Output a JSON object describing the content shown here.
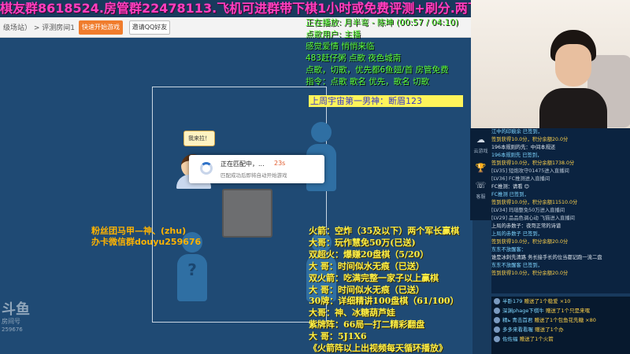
{
  "marquee": "棋友群8618524.房管群22478113.飞机可进群带下棋1小时或免费评测+刷分.两飞机或钻粉升房管",
  "game_topbar": {
    "breadcrumb": "级场站） > 评测房间1",
    "start_button": "快速开始游戏",
    "invite_button": "邀请QQ好友"
  },
  "game": {
    "speech_bubble": "我来拉！",
    "unknown_seat": "?",
    "matching_dialog": {
      "title": "正在匹配中，...",
      "timer": "23s",
      "subtitle": "匹配成功后即将自动开始游戏"
    }
  },
  "song_overlay": {
    "lines": [
      "正在播放: 月半弯 - 陈坤 (00:57 / 04:10)",
      "点歌用户: 主播",
      "感觉爱情 悄悄来临",
      "483赶仔粥 点歌 夜色城南",
      "点歌，切歌，优先都6鱼翅/首  房管免费",
      "指令：点歌  歌名       优先，歌名    切歌"
    ],
    "weekly_badge": "上周宇宙第一男神：断眉123"
  },
  "fans_overlay": {
    "lines": [
      "粉丝团马甲—神、(zhu)",
      "办卡微信群douyu259676"
    ]
  },
  "schedule_overlay": {
    "lines": [
      "火箭：空炸（35及以下）两个军长赢棋",
      "大哥：玩作慧免50万(已送)",
      "双超火：爆赚20盘棋（5/20）",
      "大    哥：时间似水无痕（已送）",
      "双火箭：吃满完整一家子以上赢棋",
      "大    哥：时间似水无痕（已送）",
      "30牌：详细精讲100盘棋（61/100）",
      "大哥：神、冰糖葫芦娃",
      "紫牌阵：66局一打二精彩翻盘",
      "大    哥：5J1X6",
      "《火箭阵以上出视频每天循环播放》"
    ]
  },
  "watermark": {
    "mark": "斗鱼",
    "text": "房间号",
    "room_id": "259676"
  },
  "side_app": {
    "items": [
      {
        "label": "云游戏",
        "icon": "cloud-game-icon"
      },
      {
        "label": "",
        "icon": "trophy-icon"
      },
      {
        "label": "客服",
        "icon": "headset-icon"
      }
    ]
  },
  "chat": {
    "lines": [
      {
        "text": "江中的印痕余 已签到，",
        "color": "#7fd6ff"
      },
      {
        "text": "签到获得10.0分，积分余额20.0分",
        "color": "#ffd24a"
      },
      {
        "text": "196本规则的先：中间本规还",
        "color": "#dfe6ee"
      },
      {
        "text": "196本规则先 已签到，",
        "color": "#7fd6ff"
      },
      {
        "text": "签到获得10.0分，积分余额1738.0分",
        "color": "#ffd24a"
      },
      {
        "text": "[LV35] 短炮攻守01475进入直播间",
        "color": "#b9c6d4"
      },
      {
        "text": "[LV36] FC推测进入直播间",
        "color": "#b9c6d4"
      },
      {
        "text": "FC推测：请看 😊",
        "color": "#dfe6ee"
      },
      {
        "text": "FC推测 已签到，",
        "color": "#7fd6ff"
      },
      {
        "text": "签到获得10.0分，积分余额11510.0分",
        "color": "#ffd24a"
      },
      {
        "text": "[LV34] 玛瑙整免50万进入直播间",
        "color": "#b9c6d4"
      },
      {
        "text": "[LV29] 品品色调心动 飞猫进入直播间",
        "color": "#b9c6d4"
      },
      {
        "text": "上局的赤数子：夜哥正常的诗谱",
        "color": "#dfe6ee"
      },
      {
        "text": "上局的赤数子 已签到，",
        "color": "#7fd6ff"
      },
      {
        "text": "签到获得10.0分，积分余额20.0分",
        "color": "#ffd24a"
      },
      {
        "text": "东东不放醒客：",
        "color": "#7fd6ff"
      },
      {
        "text": "谁是冰刺先清路 务长接手长的位当都记跑一流二盘",
        "color": "#dfe6ee"
      },
      {
        "text": "东东不放醒客 已签到，",
        "color": "#7fd6ff"
      },
      {
        "text": "签到获得10.0分，积分余额20.0分",
        "color": "#ffd24a"
      }
    ]
  },
  "gifts": {
    "rows": [
      {
        "user": "半卧179",
        "action": "赠送了1个稳爱 ×10"
      },
      {
        "user": "深渊phage下棋牛",
        "action": "赠送了1个只是来嘿"
      },
      {
        "user": "精ь 青击首君",
        "action": "赠送了1个包鱼花先糖 ×80"
      },
      {
        "user": "多多来看看喔",
        "action": "赠送了1个办"
      },
      {
        "user": "佐佐福",
        "action": "赠送了1个火箭"
      }
    ]
  },
  "colors": {
    "marquee": "#ff3fbf",
    "song_text": "#5cff3a",
    "fans_text": "#ffb300",
    "schedule_text": "#fff045",
    "start_button": "#f07c2c"
  }
}
